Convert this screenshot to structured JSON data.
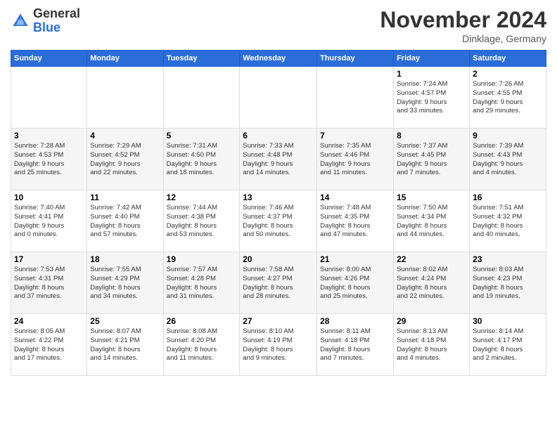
{
  "header": {
    "logo_general": "General",
    "logo_blue": "Blue",
    "month_title": "November 2024",
    "location": "Dinklage, Germany"
  },
  "weekdays": [
    "Sunday",
    "Monday",
    "Tuesday",
    "Wednesday",
    "Thursday",
    "Friday",
    "Saturday"
  ],
  "weeks": [
    [
      {
        "day": "",
        "info": ""
      },
      {
        "day": "",
        "info": ""
      },
      {
        "day": "",
        "info": ""
      },
      {
        "day": "",
        "info": ""
      },
      {
        "day": "",
        "info": ""
      },
      {
        "day": "1",
        "info": "Sunrise: 7:24 AM\nSunset: 4:57 PM\nDaylight: 9 hours\nand 33 minutes."
      },
      {
        "day": "2",
        "info": "Sunrise: 7:26 AM\nSunset: 4:55 PM\nDaylight: 9 hours\nand 29 minutes."
      }
    ],
    [
      {
        "day": "3",
        "info": "Sunrise: 7:28 AM\nSunset: 4:53 PM\nDaylight: 9 hours\nand 25 minutes."
      },
      {
        "day": "4",
        "info": "Sunrise: 7:29 AM\nSunset: 4:52 PM\nDaylight: 9 hours\nand 22 minutes."
      },
      {
        "day": "5",
        "info": "Sunrise: 7:31 AM\nSunset: 4:50 PM\nDaylight: 9 hours\nand 18 minutes."
      },
      {
        "day": "6",
        "info": "Sunrise: 7:33 AM\nSunset: 4:48 PM\nDaylight: 9 hours\nand 14 minutes."
      },
      {
        "day": "7",
        "info": "Sunrise: 7:35 AM\nSunset: 4:46 PM\nDaylight: 9 hours\nand 11 minutes."
      },
      {
        "day": "8",
        "info": "Sunrise: 7:37 AM\nSunset: 4:45 PM\nDaylight: 9 hours\nand 7 minutes."
      },
      {
        "day": "9",
        "info": "Sunrise: 7:39 AM\nSunset: 4:43 PM\nDaylight: 9 hours\nand 4 minutes."
      }
    ],
    [
      {
        "day": "10",
        "info": "Sunrise: 7:40 AM\nSunset: 4:41 PM\nDaylight: 9 hours\nand 0 minutes."
      },
      {
        "day": "11",
        "info": "Sunrise: 7:42 AM\nSunset: 4:40 PM\nDaylight: 8 hours\nand 57 minutes."
      },
      {
        "day": "12",
        "info": "Sunrise: 7:44 AM\nSunset: 4:38 PM\nDaylight: 8 hours\nand 53 minutes."
      },
      {
        "day": "13",
        "info": "Sunrise: 7:46 AM\nSunset: 4:37 PM\nDaylight: 8 hours\nand 50 minutes."
      },
      {
        "day": "14",
        "info": "Sunrise: 7:48 AM\nSunset: 4:35 PM\nDaylight: 8 hours\nand 47 minutes."
      },
      {
        "day": "15",
        "info": "Sunrise: 7:50 AM\nSunset: 4:34 PM\nDaylight: 8 hours\nand 44 minutes."
      },
      {
        "day": "16",
        "info": "Sunrise: 7:51 AM\nSunset: 4:32 PM\nDaylight: 8 hours\nand 40 minutes."
      }
    ],
    [
      {
        "day": "17",
        "info": "Sunrise: 7:53 AM\nSunset: 4:31 PM\nDaylight: 8 hours\nand 37 minutes."
      },
      {
        "day": "18",
        "info": "Sunrise: 7:55 AM\nSunset: 4:29 PM\nDaylight: 8 hours\nand 34 minutes."
      },
      {
        "day": "19",
        "info": "Sunrise: 7:57 AM\nSunset: 4:28 PM\nDaylight: 8 hours\nand 31 minutes."
      },
      {
        "day": "20",
        "info": "Sunrise: 7:58 AM\nSunset: 4:27 PM\nDaylight: 8 hours\nand 28 minutes."
      },
      {
        "day": "21",
        "info": "Sunrise: 8:00 AM\nSunset: 4:26 PM\nDaylight: 8 hours\nand 25 minutes."
      },
      {
        "day": "22",
        "info": "Sunrise: 8:02 AM\nSunset: 4:24 PM\nDaylight: 8 hours\nand 22 minutes."
      },
      {
        "day": "23",
        "info": "Sunrise: 8:03 AM\nSunset: 4:23 PM\nDaylight: 8 hours\nand 19 minutes."
      }
    ],
    [
      {
        "day": "24",
        "info": "Sunrise: 8:05 AM\nSunset: 4:22 PM\nDaylight: 8 hours\nand 17 minutes."
      },
      {
        "day": "25",
        "info": "Sunrise: 8:07 AM\nSunset: 4:21 PM\nDaylight: 8 hours\nand 14 minutes."
      },
      {
        "day": "26",
        "info": "Sunrise: 8:08 AM\nSunset: 4:20 PM\nDaylight: 8 hours\nand 11 minutes."
      },
      {
        "day": "27",
        "info": "Sunrise: 8:10 AM\nSunset: 4:19 PM\nDaylight: 8 hours\nand 9 minutes."
      },
      {
        "day": "28",
        "info": "Sunrise: 8:11 AM\nSunset: 4:18 PM\nDaylight: 8 hours\nand 7 minutes."
      },
      {
        "day": "29",
        "info": "Sunrise: 8:13 AM\nSunset: 4:18 PM\nDaylight: 8 hours\nand 4 minutes."
      },
      {
        "day": "30",
        "info": "Sunrise: 8:14 AM\nSunset: 4:17 PM\nDaylight: 8 hours\nand 2 minutes."
      }
    ]
  ]
}
